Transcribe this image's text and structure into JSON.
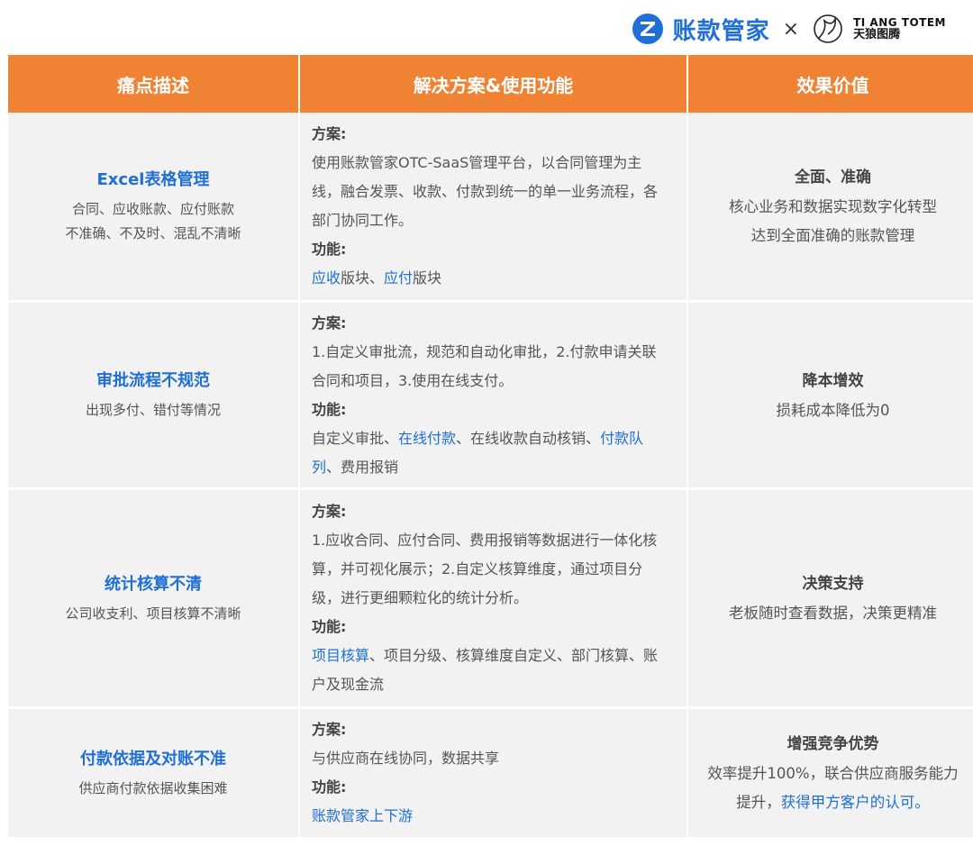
{
  "brand": {
    "app_name": "账款管家",
    "times": "×",
    "partner_en": "TI ANG TOTEM",
    "partner_cn": "天狼图腾",
    "accent": "#1f6fd6",
    "header_color": "#ef8233"
  },
  "headers": [
    "痛点描述",
    "解决方案&使用功能",
    "效果价值"
  ],
  "rows": [
    {
      "pain_title": "Excel表格管理",
      "pain_desc": [
        "合同、应收账款、应付账款",
        "不准确、不及时、混乱不清晰"
      ],
      "plan_label": "方案:",
      "plan_text": "使用账款管家OTC-SaaS管理平台，以合同管理为主线，融合发票、收款、付款到统一的单一业务流程，各部门协同工作。",
      "func_label": "功能:",
      "func_parts": [
        {
          "text": "应收",
          "link": true
        },
        {
          "text": "版块、",
          "link": false
        },
        {
          "text": "应付",
          "link": true
        },
        {
          "text": "版块",
          "link": false
        }
      ],
      "value_title": "全面、准确",
      "value_desc": [
        "核心业务和数据实现数字化转型",
        "达到全面准确的账款管理"
      ]
    },
    {
      "pain_title": "审批流程不规范",
      "pain_desc": [
        "出现多付、错付等情况"
      ],
      "plan_label": "方案:",
      "plan_text": "1.自定义审批流，规范和自动化审批，2.付款申请关联合同和项目，3.使用在线支付。",
      "func_label": "功能:",
      "func_parts": [
        {
          "text": "自定义审批、",
          "link": false
        },
        {
          "text": "在线付款",
          "link": true
        },
        {
          "text": "、在线收款自动核销、",
          "link": false
        },
        {
          "text": "付款队列",
          "link": true
        },
        {
          "text": "、费用报销",
          "link": false
        }
      ],
      "value_title": "降本增效",
      "value_desc": [
        "损耗成本降低为0"
      ]
    },
    {
      "pain_title": "统计核算不清",
      "pain_desc": [
        "公司收支利、项目核算不清晰"
      ],
      "plan_label": "方案:",
      "plan_text": "1.应收合同、应付合同、费用报销等数据进行一体化核算，并可视化展示；2.自定义核算维度，通过项目分级，进行更细颗粒化的统计分析。",
      "func_label": "功能:",
      "func_parts": [
        {
          "text": "项目核算",
          "link": true
        },
        {
          "text": "、项目分级、核算维度自定义、部门核算、账户及现金流",
          "link": false
        }
      ],
      "value_title": "决策支持",
      "value_desc": [
        "老板随时查看数据，决策更精准"
      ]
    },
    {
      "pain_title": "付款依据及对账不准",
      "pain_desc": [
        "供应商付款依据收集困难"
      ],
      "plan_label": "方案:",
      "plan_text": "与供应商在线协同，数据共享",
      "func_label": "功能:",
      "func_parts": [
        {
          "text": "账款管家上下游",
          "link": true
        }
      ],
      "value_title": "增强竞争优势",
      "value_desc_parts": [
        {
          "text": "效率提升100%，联合供应商服务能力提升，",
          "link": false
        },
        {
          "text": "获得甲方客户的认可。",
          "link": true
        }
      ]
    }
  ]
}
